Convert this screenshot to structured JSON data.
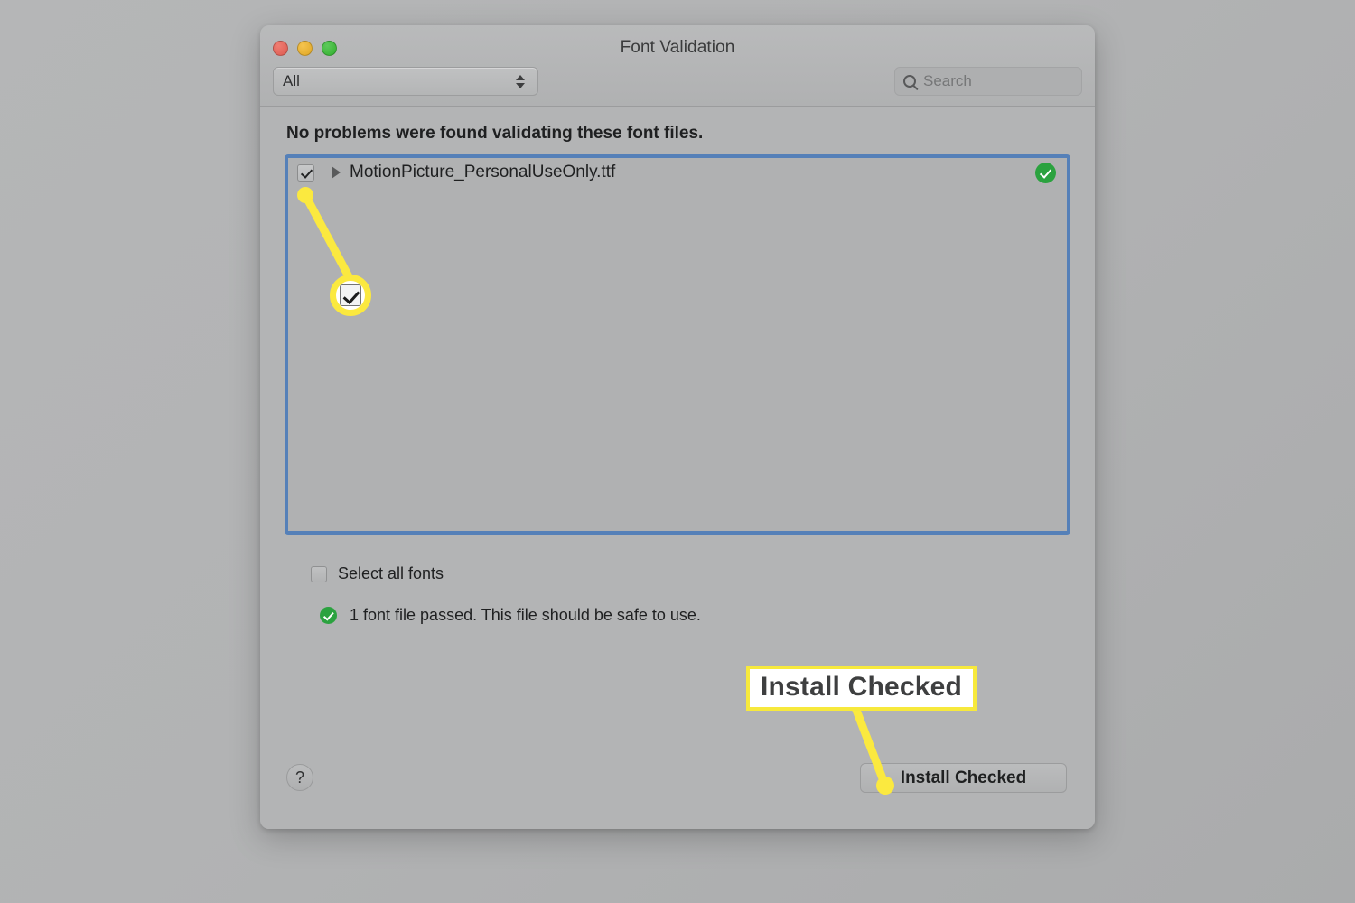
{
  "window": {
    "title": "Font Validation",
    "traffic_lights": [
      "close-button",
      "minimize-button",
      "maximize-button"
    ]
  },
  "toolbar": {
    "filter": {
      "selected": "All",
      "options": [
        "All"
      ],
      "icon": "stepper-updown-icon"
    },
    "search": {
      "value": "",
      "placeholder": "Search",
      "icon": "search-icon"
    }
  },
  "main": {
    "headline": "No problems were found validating these font files.",
    "font_list": {
      "columns": [
        "checkbox",
        "disclosure",
        "name",
        "status"
      ],
      "rows": [
        {
          "checked": true,
          "name": "MotionPicture_PersonalUseOnly.ttf",
          "status_icon": "green-check-icon",
          "expanded": false
        }
      ]
    },
    "select_all": {
      "label": "Select all fonts",
      "checked": false
    },
    "summary": {
      "icon": "green-check-icon",
      "text": "1 font file passed. This file should be safe to use."
    },
    "help_button": {
      "label": "?"
    },
    "install_button": {
      "label": "Install Checked"
    }
  },
  "annotations": {
    "checkbox_callout": {
      "type": "magnifier",
      "target": "row-checkbox",
      "checked": true
    },
    "button_callout": {
      "type": "label",
      "text": "Install Checked",
      "target": "install-checked-button"
    },
    "highlight_color": "#fbe93f"
  }
}
